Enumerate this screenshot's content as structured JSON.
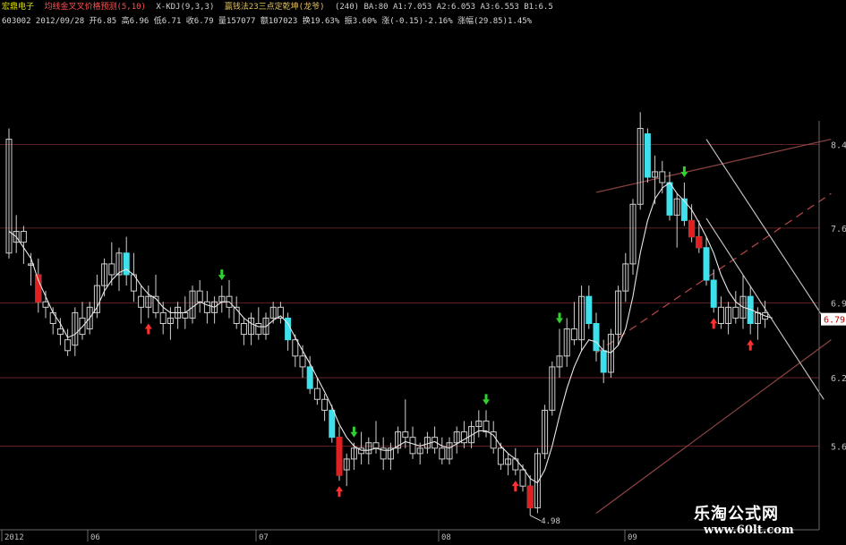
{
  "header": {
    "stock_name": "宏鼎电子",
    "indicator1": "均线金叉叉价格预测(5,10)",
    "indicator2": "X-KDJ(9,3,3)",
    "indicator3": "赢钱法23三点定乾坤(龙爷)",
    "params": "(240) BA:80 A1:7.053 A2:6.053 A3:6.553 B1:6.5",
    "info": "603002 2012/09/28 开6.85 高6.96 低6.71 收6.79 量157077 额107023 换19.63% 振3.60% 涨(-0.15)-2.16% 涨幅(29.85)1.45%"
  },
  "chart_data": {
    "type": "candlestick",
    "yaxis": {
      "ticks": [
        8.4,
        7.63,
        6.94,
        6.25,
        5.62
      ],
      "labels": [
        "8.40",
        "7.63",
        "6.94",
        "6.25",
        "5.62"
      ],
      "range": [
        4.88,
        8.62
      ]
    },
    "xaxis": {
      "labels": [
        "2012",
        "06",
        "07",
        "08",
        "09"
      ]
    },
    "current_price": "6.79",
    "low_marker": "4.98",
    "candles": [
      [
        7.4,
        8.55,
        7.35,
        8.45
      ],
      [
        7.5,
        7.75,
        7.4,
        7.6
      ],
      [
        7.6,
        7.65,
        7.3,
        7.5
      ],
      [
        7.3,
        7.4,
        7.1,
        7.3
      ],
      [
        7.2,
        7.35,
        6.85,
        6.95
      ],
      [
        6.95,
        7.05,
        6.8,
        6.9
      ],
      [
        6.85,
        6.9,
        6.65,
        6.75
      ],
      [
        6.7,
        6.8,
        6.55,
        6.65
      ],
      [
        6.6,
        6.7,
        6.45,
        6.5
      ],
      [
        6.55,
        6.9,
        6.45,
        6.85
      ],
      [
        6.8,
        6.95,
        6.6,
        6.65
      ],
      [
        6.7,
        6.95,
        6.65,
        6.9
      ],
      [
        6.85,
        7.2,
        6.8,
        7.1
      ],
      [
        7.1,
        7.35,
        7.0,
        7.3
      ],
      [
        7.3,
        7.5,
        7.1,
        7.2
      ],
      [
        7.2,
        7.45,
        7.05,
        7.4
      ],
      [
        7.4,
        7.55,
        7.1,
        7.2
      ],
      [
        7.2,
        7.4,
        6.95,
        7.05
      ],
      [
        7.0,
        7.1,
        6.75,
        6.9
      ],
      [
        6.9,
        7.1,
        6.8,
        7.0
      ],
      [
        7.0,
        7.2,
        6.8,
        6.85
      ],
      [
        6.85,
        6.95,
        6.65,
        6.75
      ],
      [
        6.75,
        6.9,
        6.6,
        6.8
      ],
      [
        6.8,
        6.95,
        6.7,
        6.9
      ],
      [
        6.85,
        7.0,
        6.7,
        6.8
      ],
      [
        6.8,
        7.1,
        6.75,
        7.05
      ],
      [
        7.05,
        7.15,
        6.85,
        6.95
      ],
      [
        6.95,
        7.05,
        6.75,
        6.85
      ],
      [
        6.85,
        7.0,
        6.75,
        6.95
      ],
      [
        6.95,
        7.1,
        6.85,
        7.0
      ],
      [
        7.0,
        7.15,
        6.8,
        6.9
      ],
      [
        6.9,
        7.0,
        6.7,
        6.75
      ],
      [
        6.75,
        6.8,
        6.55,
        6.65
      ],
      [
        6.65,
        6.85,
        6.55,
        6.8
      ],
      [
        6.75,
        6.9,
        6.6,
        6.65
      ],
      [
        6.65,
        6.85,
        6.6,
        6.8
      ],
      [
        6.8,
        6.95,
        6.75,
        6.9
      ],
      [
        6.9,
        6.95,
        6.75,
        6.8
      ],
      [
        6.8,
        6.85,
        6.5,
        6.6
      ],
      [
        6.6,
        6.65,
        6.35,
        6.45
      ],
      [
        6.45,
        6.55,
        6.25,
        6.35
      ],
      [
        6.35,
        6.45,
        6.1,
        6.15
      ],
      [
        6.15,
        6.25,
        6.0,
        6.05
      ],
      [
        6.05,
        6.1,
        5.85,
        5.95
      ],
      [
        5.95,
        6.0,
        5.65,
        5.7
      ],
      [
        5.7,
        5.8,
        5.3,
        5.35
      ],
      [
        5.4,
        5.55,
        5.25,
        5.5
      ],
      [
        5.5,
        5.65,
        5.4,
        5.6
      ],
      [
        5.6,
        5.75,
        5.45,
        5.55
      ],
      [
        5.55,
        5.7,
        5.45,
        5.65
      ],
      [
        5.65,
        5.85,
        5.55,
        5.6
      ],
      [
        5.6,
        5.7,
        5.4,
        5.5
      ],
      [
        5.5,
        5.65,
        5.4,
        5.6
      ],
      [
        5.6,
        5.8,
        5.55,
        5.75
      ],
      [
        5.75,
        6.05,
        5.6,
        5.7
      ],
      [
        5.7,
        5.8,
        5.5,
        5.55
      ],
      [
        5.55,
        5.65,
        5.45,
        5.6
      ],
      [
        5.6,
        5.75,
        5.55,
        5.7
      ],
      [
        5.7,
        5.8,
        5.55,
        5.6
      ],
      [
        5.6,
        5.7,
        5.45,
        5.5
      ],
      [
        5.5,
        5.7,
        5.45,
        5.65
      ],
      [
        5.65,
        5.8,
        5.55,
        5.75
      ],
      [
        5.75,
        5.85,
        5.6,
        5.65
      ],
      [
        5.65,
        5.85,
        5.6,
        5.8
      ],
      [
        5.8,
        5.95,
        5.7,
        5.85
      ],
      [
        5.85,
        5.95,
        5.7,
        5.75
      ],
      [
        5.75,
        5.85,
        5.55,
        5.6
      ],
      [
        5.6,
        5.65,
        5.4,
        5.45
      ],
      [
        5.45,
        5.55,
        5.35,
        5.5
      ],
      [
        5.5,
        5.6,
        5.35,
        5.4
      ],
      [
        5.4,
        5.45,
        5.2,
        5.25
      ],
      [
        5.25,
        5.35,
        4.98,
        5.05
      ],
      [
        5.05,
        5.6,
        5.0,
        5.55
      ],
      [
        5.55,
        6.0,
        5.5,
        5.95
      ],
      [
        5.95,
        6.4,
        5.9,
        6.35
      ],
      [
        6.35,
        6.7,
        6.25,
        6.45
      ],
      [
        6.45,
        6.8,
        6.35,
        6.7
      ],
      [
        6.7,
        6.95,
        6.55,
        6.6
      ],
      [
        6.6,
        7.1,
        6.5,
        7.0
      ],
      [
        7.0,
        7.1,
        6.7,
        6.75
      ],
      [
        6.75,
        6.85,
        6.4,
        6.5
      ],
      [
        6.5,
        6.6,
        6.2,
        6.3
      ],
      [
        6.3,
        6.7,
        6.25,
        6.65
      ],
      [
        6.65,
        7.1,
        6.55,
        7.05
      ],
      [
        7.05,
        7.4,
        6.95,
        7.3
      ],
      [
        7.3,
        7.9,
        7.2,
        7.85
      ],
      [
        7.85,
        8.7,
        7.8,
        8.55
      ],
      [
        8.5,
        8.55,
        8.05,
        8.1
      ],
      [
        8.1,
        8.3,
        7.85,
        8.15
      ],
      [
        8.15,
        8.25,
        7.95,
        8.05
      ],
      [
        8.05,
        8.15,
        7.7,
        7.75
      ],
      [
        7.75,
        7.95,
        7.45,
        7.9
      ],
      [
        7.9,
        8.05,
        7.65,
        7.7
      ],
      [
        7.7,
        7.85,
        7.5,
        7.55
      ],
      [
        7.55,
        7.7,
        7.4,
        7.45
      ],
      [
        7.45,
        7.55,
        7.1,
        7.15
      ],
      [
        7.15,
        7.25,
        6.85,
        6.9
      ],
      [
        6.9,
        7.0,
        6.7,
        6.75
      ],
      [
        6.75,
        6.95,
        6.65,
        6.9
      ],
      [
        6.9,
        7.05,
        6.75,
        6.8
      ],
      [
        6.8,
        7.2,
        6.7,
        7.0
      ],
      [
        7.0,
        7.1,
        6.65,
        6.75
      ],
      [
        6.75,
        6.9,
        6.6,
        6.85
      ],
      [
        6.85,
        6.96,
        6.71,
        6.79
      ]
    ],
    "series": [
      {
        "name": "",
        "values": [
          7.6,
          7.55,
          7.45,
          7.35,
          7.15,
          7.0,
          6.85,
          6.75,
          6.62,
          6.65,
          6.72,
          6.8,
          6.9,
          7.05,
          7.15,
          7.22,
          7.25,
          7.2,
          7.1,
          7.02,
          6.98,
          6.9,
          6.85,
          6.85,
          6.85,
          6.9,
          6.95,
          6.92,
          6.9,
          6.95,
          6.95,
          6.88,
          6.8,
          6.75,
          6.72,
          6.72,
          6.78,
          6.82,
          6.75,
          6.62,
          6.5,
          6.38,
          6.25,
          6.12,
          5.98,
          5.82,
          5.7,
          5.62,
          5.58,
          5.58,
          5.6,
          5.58,
          5.58,
          5.62,
          5.66,
          5.64,
          5.62,
          5.64,
          5.66,
          5.62,
          5.6,
          5.64,
          5.68,
          5.72,
          5.76,
          5.76,
          5.72,
          5.62,
          5.55,
          5.5,
          5.42,
          5.32,
          5.28,
          5.4,
          5.62,
          5.9,
          6.15,
          6.35,
          6.5,
          6.6,
          6.58,
          6.5,
          6.48,
          6.55,
          6.7,
          7.0,
          7.4,
          7.7,
          7.9,
          8.0,
          8.05,
          7.95,
          7.88,
          7.8,
          7.68,
          7.55,
          7.4,
          7.2,
          7.05,
          6.95,
          6.9,
          6.88,
          6.85,
          6.82,
          6.8
        ]
      }
    ],
    "arrows_up": [
      19,
      45,
      69,
      96,
      101
    ],
    "arrows_down": [
      29,
      47,
      65,
      75,
      92
    ],
    "channel": [
      {
        "style": "solid",
        "color": "#8e4444",
        "from": [
          80,
          7.96
        ],
        "to": [
          112,
          8.45
        ]
      },
      {
        "style": "dashed",
        "color": "#b84848",
        "from": [
          80,
          6.48
        ],
        "to": [
          112,
          7.95
        ]
      },
      {
        "style": "solid",
        "color": "#8e4444",
        "from": [
          80,
          5.0
        ],
        "to": [
          112,
          6.6
        ]
      },
      {
        "style": "solid",
        "color": "#bdbdbd",
        "from": [
          95,
          8.45
        ],
        "to": [
          111,
          6.8
        ]
      },
      {
        "style": "solid",
        "color": "#bdbdbd",
        "from": [
          95,
          7.72
        ],
        "to": [
          111,
          6.05
        ]
      }
    ]
  },
  "watermark": {
    "name": "乐淘公式网",
    "url": "www.60lt.com"
  }
}
